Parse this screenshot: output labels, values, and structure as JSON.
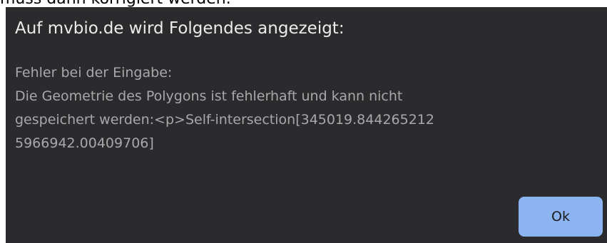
{
  "background": {
    "partial_text": "muss dann korrigiert werden."
  },
  "dialog": {
    "title": "Auf mvbio.de wird Folgendes angezeigt:",
    "message_lines": [
      "Fehler bei der Eingabe:",
      "Die Geometrie des Polygons ist fehlerhaft und kann nicht",
      "gespeichert werden:<p>Self-intersection[345019.844265212",
      "5966942.00409706]"
    ],
    "ok_label": "Ok",
    "colors": {
      "background": "#2b2b2d",
      "title": "#ececec",
      "message": "#a8a8aa",
      "button": "#8cb4f0",
      "button_text": "#1c1c1e"
    }
  }
}
